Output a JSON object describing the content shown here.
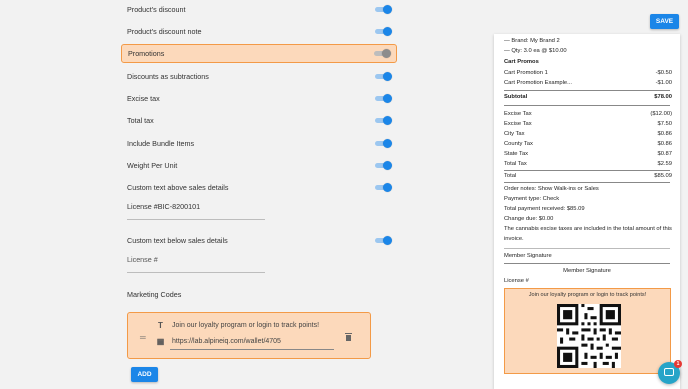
{
  "settings": {
    "toggles": [
      {
        "label": "Product's discount",
        "on": true
      },
      {
        "label": "Product's discount note",
        "on": true
      },
      {
        "label": "Promotions",
        "on": false
      },
      {
        "label": "Discounts as subtractions",
        "on": true
      },
      {
        "label": "Excise tax",
        "on": true
      },
      {
        "label": "Total tax",
        "on": true
      },
      {
        "label": "Include Bundle Items",
        "on": true
      },
      {
        "label": "Weight Per Unit",
        "on": true
      },
      {
        "label": "Custom text above sales details",
        "on": true
      },
      {
        "label": "Custom text below sales details",
        "on": true
      }
    ],
    "license_above_value": "License #BIC-8200101",
    "license_below_placeholder": "License #",
    "marketing_codes_label": "Marketing Codes",
    "marketing_code": {
      "text": "Join our loyalty program or login to track points!",
      "url": "https://lab.alpineiq.com/wallet/4705"
    },
    "add_label": "ADD"
  },
  "save_label": "SAVE",
  "receipt": {
    "brand_line": "— Brand: My Brand 2",
    "qty_line": "— Qty: 3.0 ea @ $10.00",
    "cart_promos_heading": "Cart Promos",
    "promos": [
      {
        "name": "Cart Promotion 1",
        "amount": "-$0.50"
      },
      {
        "name": "Cart Promotion Example...",
        "amount": "-$1.00"
      }
    ],
    "subtotal": {
      "label": "Subtotal",
      "amount": "$78.00"
    },
    "taxes": [
      {
        "name": "Excise Tax",
        "amount": "($12.00)"
      },
      {
        "name": "Excise Tax",
        "amount": "$7.50"
      },
      {
        "name": "City Tax",
        "amount": "$0.86"
      },
      {
        "name": "County Tax",
        "amount": "$0.86"
      },
      {
        "name": "State Tax",
        "amount": "$0.87"
      },
      {
        "name": "Total Tax",
        "amount": "$2.59"
      }
    ],
    "total": {
      "label": "Total",
      "amount": "$85.09"
    },
    "notes": [
      "Order notes: Show Walk-ins or Sales",
      "Payment type: Check",
      "Total payment received: $85.09",
      "Change due: $0.00",
      "The cannabis excise taxes are included in the total amount of this invoice."
    ],
    "member_signature_label": "Member Signature",
    "member_signature_center": "Member Signature",
    "license_label": "License #",
    "promo_text": "Join our loyalty program or login to track points!"
  },
  "chat_badge": "1",
  "colors": {
    "accent": "#1b86e8",
    "highlight_bg": "#fcd9bb",
    "highlight_border": "#f39a47"
  }
}
